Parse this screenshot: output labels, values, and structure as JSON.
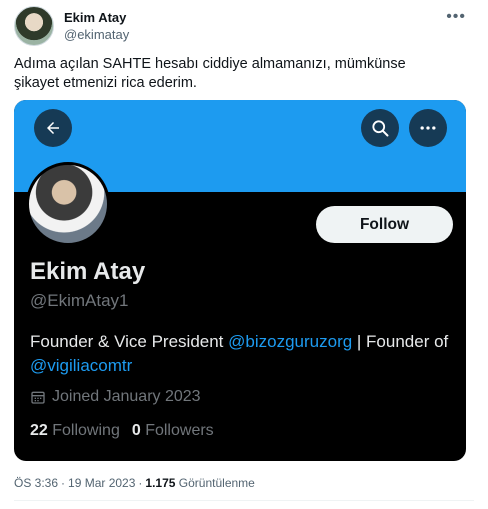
{
  "tweet": {
    "author_name": "Ekim Atay",
    "author_handle": "@ekimatay",
    "more_icon": "ellipsis-icon",
    "text": "Adıma açılan SAHTE hesabı ciddiye almamanızı, mümkünse şikayet etmenizi rica ederim."
  },
  "card": {
    "buttons": {
      "back_icon": "arrow-left-icon",
      "search_icon": "search-icon",
      "more_icon": "ellipsis-icon"
    },
    "follow_label": "Follow",
    "display_name": "Ekim Atay",
    "handle": "@EkimAtay1",
    "bio": {
      "part1": "Founder & Vice President ",
      "mention1": "@bizozguruzorg",
      "part2": " | Founder of ",
      "mention2": "@vigiliacomtr"
    },
    "joined": "Joined January 2023",
    "following_count": "22",
    "following_label": "Following",
    "followers_count": "0",
    "followers_label": "Followers",
    "colors": {
      "banner": "#1d9bf0",
      "background": "#000000",
      "link": "#1d9bf0"
    }
  },
  "meta": {
    "time": "ÖS 3:36",
    "date": "19 Mar 2023",
    "views_count": "1.175",
    "views_label": "Görüntülenme"
  }
}
